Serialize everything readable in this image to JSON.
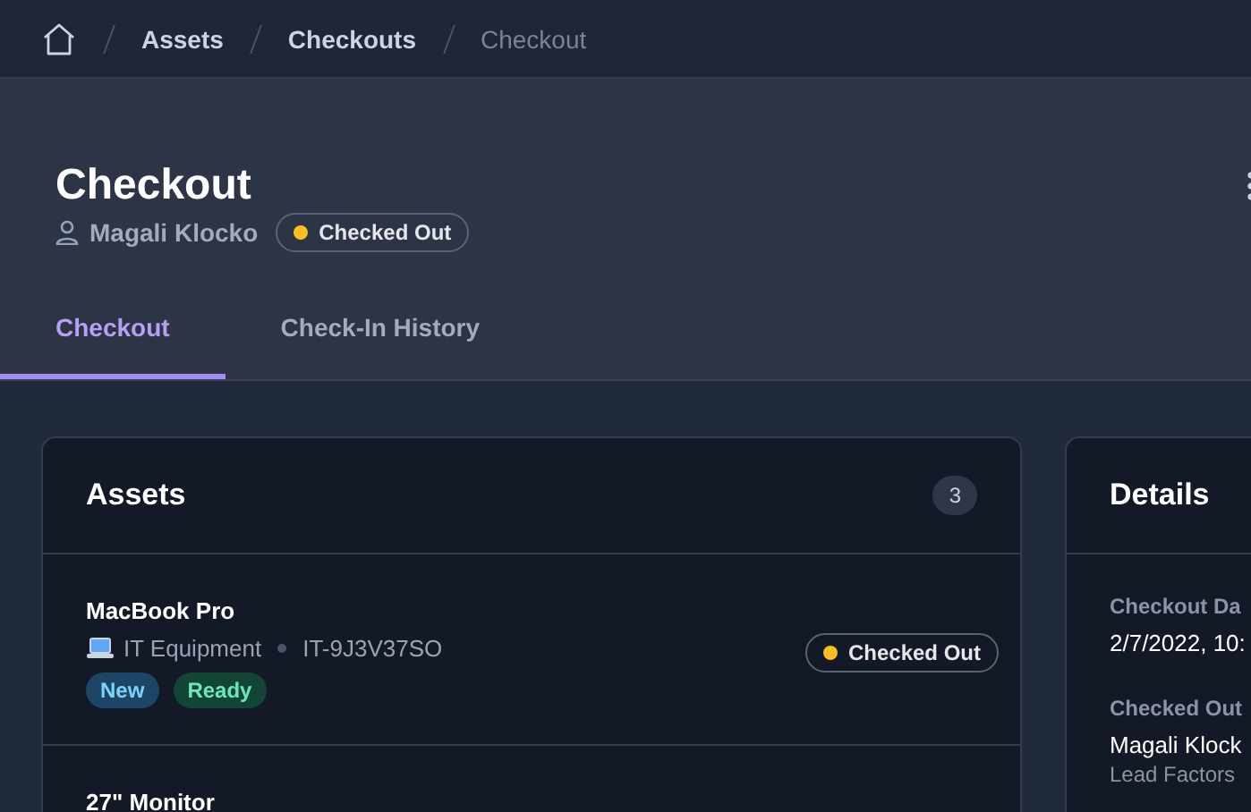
{
  "breadcrumbs": [
    {
      "label": "Assets",
      "current": false
    },
    {
      "label": "Checkouts",
      "current": false
    },
    {
      "label": "Checkout",
      "current": true
    }
  ],
  "header": {
    "title": "Checkout",
    "user": "Magali Klocko",
    "status": {
      "label": "Checked Out",
      "color": "#fbbf24"
    }
  },
  "tabs": [
    {
      "label": "Checkout",
      "selected": true
    },
    {
      "label": "Check-In History",
      "selected": false
    }
  ],
  "assets_card": {
    "title": "Assets",
    "count": "3",
    "items": [
      {
        "name": "MacBook Pro",
        "category": "IT Equipment",
        "asset_tag": "IT-9J3V37SO",
        "tags": [
          {
            "label": "New",
            "kind": "info"
          },
          {
            "label": "Ready",
            "kind": "success"
          }
        ],
        "status": {
          "label": "Checked Out",
          "color": "#fbbf24"
        }
      },
      {
        "name": "27\" Monitor"
      }
    ]
  },
  "details_card": {
    "title": "Details",
    "fields": [
      {
        "label": "Checkout Da",
        "value": "2/7/2022, 10:"
      },
      {
        "label": "Checked Out",
        "value": "Magali Klock",
        "sub": "Lead Factors"
      }
    ]
  }
}
